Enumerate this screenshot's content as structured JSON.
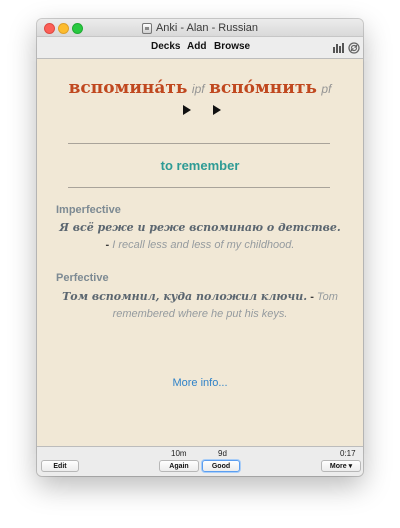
{
  "window": {
    "title": "Anki - Alan - Russian"
  },
  "toolbar": {
    "decks_label": "Decks",
    "add_label": "Add",
    "browse_label": "Browse",
    "stats_icon": "bar-chart-icon",
    "sync_icon": "sync-icon"
  },
  "card": {
    "word_ipf": "вспомина́ть",
    "aspect_ipf": "ipf",
    "word_pf": "вспо́мнить",
    "aspect_pf": "pf",
    "meaning": "to remember",
    "imperfective": {
      "label": "Imperfective",
      "ru": "Я всё реже и реже вспоминаю о детстве.",
      "dash": "-",
      "en": "I recall less and less of my childhood."
    },
    "perfective": {
      "label": "Perfective",
      "ru": "Том вспомнил, куда положил ключи.",
      "dash": "-",
      "en": "Tom remembered where he put his keys."
    },
    "more_info": "More info..."
  },
  "bottom": {
    "edit_label": "Edit",
    "again_interval": "10m",
    "again_label": "Again",
    "good_interval": "9d",
    "good_label": "Good",
    "timer": "0:17",
    "more_label": "More ▾"
  },
  "colors": {
    "card_background": "#f1e8d6",
    "russian_word": "#c0481f",
    "meaning": "#2e9b95",
    "link": "#2f82c8"
  }
}
